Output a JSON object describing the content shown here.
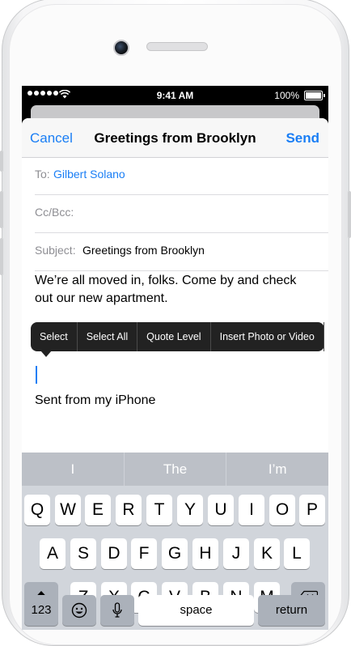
{
  "status_bar": {
    "time": "9:41 AM",
    "battery_percent": "100%",
    "signal_bars": 5
  },
  "compose": {
    "nav": {
      "cancel_label": "Cancel",
      "title": "Greetings from Brooklyn",
      "send_label": "Send"
    },
    "to_label": "To:",
    "to_value": "Gilbert Solano",
    "ccbcc_label": "Cc/Bcc:",
    "subject_label": "Subject:",
    "subject_value": "Greetings from Brooklyn",
    "body_text": "We’re all moved in, folks. Come by and check out our new apartment.",
    "signature": "Sent from my iPhone"
  },
  "edit_menu": {
    "items": [
      "Select",
      "Select All",
      "Quote Level",
      "Insert Photo or Video"
    ]
  },
  "keyboard": {
    "predictions": [
      "I",
      "The",
      "I’m"
    ],
    "row1": [
      "Q",
      "W",
      "E",
      "R",
      "T",
      "Y",
      "U",
      "I",
      "O",
      "P"
    ],
    "row2": [
      "A",
      "S",
      "D",
      "F",
      "G",
      "H",
      "J",
      "K",
      "L"
    ],
    "row3": [
      "Z",
      "X",
      "C",
      "V",
      "B",
      "N",
      "M"
    ],
    "numbers_label": "123",
    "space_label": "space",
    "return_label": "return",
    "icons": {
      "shift": "shift-arrow-icon",
      "delete": "backspace-icon",
      "emoji": "emoji-icon",
      "mic": "microphone-icon"
    }
  },
  "colors": {
    "accent": "#1a7ef5",
    "keyboard_bg": "#d1d5db",
    "prediction_bar": "#bcc0c7",
    "callout_bg": "#222222"
  }
}
